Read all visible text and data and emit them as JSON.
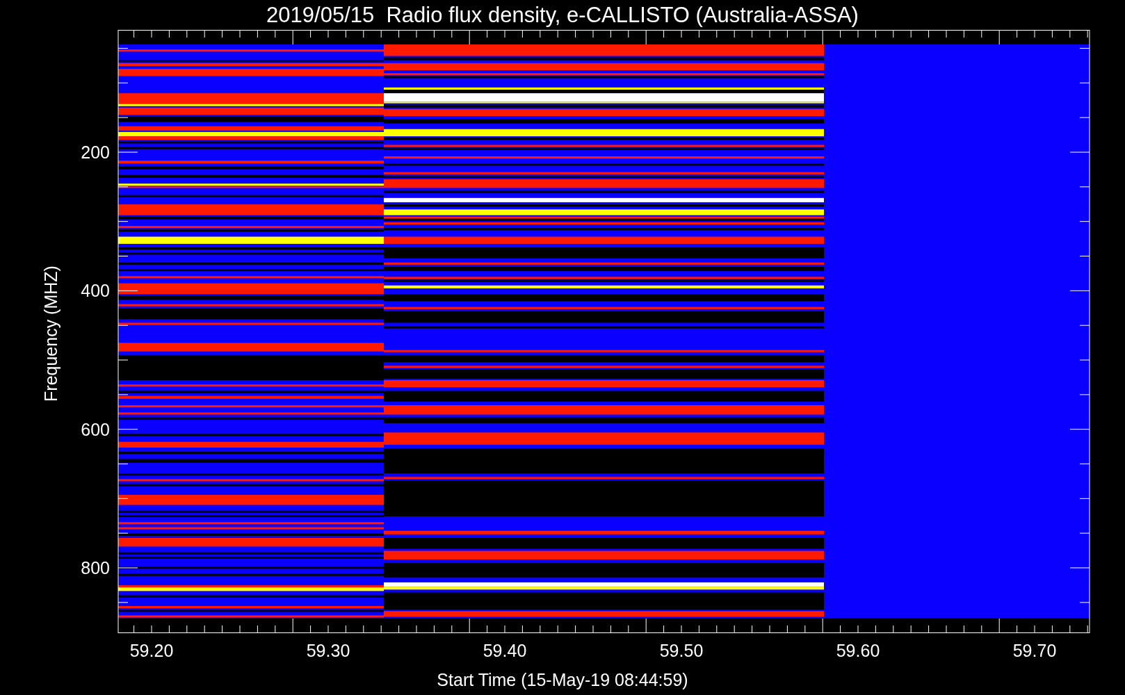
{
  "title": "2019/05/15  Radio flux density, e-CALLISTO (Australia-ASSA)",
  "plot": {
    "y_axis": {
      "label": "Frequency (MHZ)",
      "tick_labels": [
        "200",
        "400",
        "600",
        "800"
      ]
    },
    "x_axis": {
      "label": "Start Time (15-May-19 08:44:59)",
      "tick_labels": [
        "59.20",
        "59.30",
        "59.40",
        "59.50",
        "59.60",
        "59.70"
      ]
    }
  }
}
